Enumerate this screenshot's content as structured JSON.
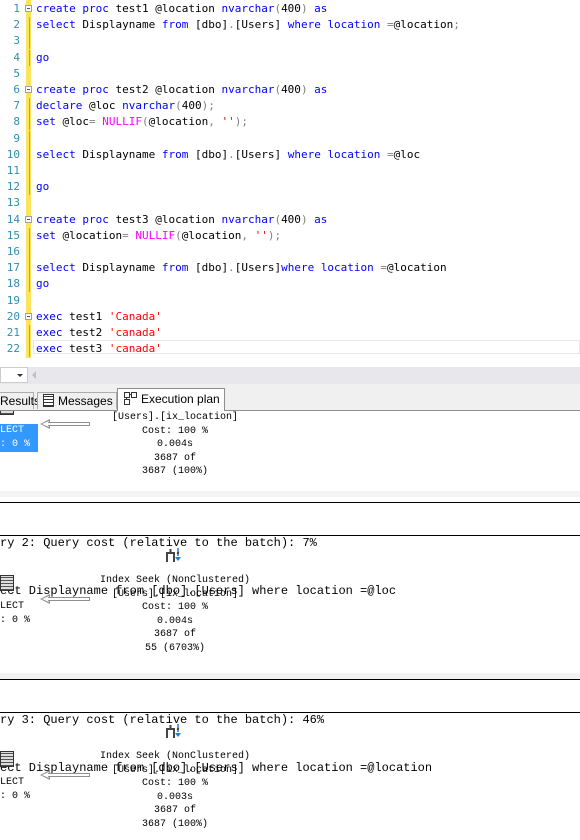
{
  "editor": {
    "lines": [
      {
        "n": "1",
        "fold": true,
        "segments": [
          [
            "kw",
            "create proc "
          ],
          [
            "",
            "test1 @location "
          ],
          [
            "kw",
            "nvarchar"
          ],
          [
            "op",
            "("
          ],
          [
            "",
            "400"
          ],
          [
            "op",
            ")"
          ],
          [
            "kw",
            " as"
          ]
        ]
      },
      {
        "n": "2",
        "segments": [
          [
            "kw",
            "select "
          ],
          [
            "",
            "Displayname "
          ],
          [
            "kw",
            "from "
          ],
          [
            "",
            "[dbo]"
          ],
          [
            "op",
            "."
          ],
          [
            "",
            "[Users] "
          ],
          [
            "kw",
            "where location "
          ],
          [
            "op",
            "="
          ],
          [
            "",
            "@location"
          ],
          [
            "op",
            ";"
          ]
        ]
      },
      {
        "n": "3",
        "segments": []
      },
      {
        "n": "4",
        "segments": [
          [
            "kw",
            "go"
          ]
        ]
      },
      {
        "n": "5",
        "segments": []
      },
      {
        "n": "6",
        "fold": true,
        "segments": [
          [
            "kw",
            "create proc "
          ],
          [
            "",
            "test2 @location "
          ],
          [
            "kw",
            "nvarchar"
          ],
          [
            "op",
            "("
          ],
          [
            "",
            "400"
          ],
          [
            "op",
            ")"
          ],
          [
            "kw",
            " as"
          ]
        ]
      },
      {
        "n": "7",
        "segments": [
          [
            "kw",
            "declare "
          ],
          [
            "",
            "@loc "
          ],
          [
            "kw",
            "nvarchar"
          ],
          [
            "op",
            "("
          ],
          [
            "",
            "400"
          ],
          [
            "op",
            ");"
          ]
        ]
      },
      {
        "n": "8",
        "segments": [
          [
            "kw",
            "set "
          ],
          [
            "",
            "@loc"
          ],
          [
            "op",
            "= "
          ],
          [
            "fn",
            "NULLIF"
          ],
          [
            "op",
            "("
          ],
          [
            "",
            "@location"
          ],
          [
            "op",
            ", "
          ],
          [
            "str",
            "''"
          ],
          [
            "op",
            ");"
          ]
        ]
      },
      {
        "n": "9",
        "segments": []
      },
      {
        "n": "10",
        "segments": [
          [
            "kw",
            "select "
          ],
          [
            "",
            "Displayname "
          ],
          [
            "kw",
            "from "
          ],
          [
            "",
            "[dbo]"
          ],
          [
            "op",
            "."
          ],
          [
            "",
            "[Users] "
          ],
          [
            "kw",
            "where location "
          ],
          [
            "op",
            "="
          ],
          [
            "",
            "@loc"
          ]
        ]
      },
      {
        "n": "11",
        "segments": []
      },
      {
        "n": "12",
        "segments": [
          [
            "kw",
            "go"
          ]
        ]
      },
      {
        "n": "13",
        "segments": []
      },
      {
        "n": "14",
        "fold": true,
        "segments": [
          [
            "kw",
            "create proc "
          ],
          [
            "",
            "test3 @location "
          ],
          [
            "kw",
            "nvarchar"
          ],
          [
            "op",
            "("
          ],
          [
            "",
            "400"
          ],
          [
            "op",
            ")"
          ],
          [
            "kw",
            " as"
          ]
        ]
      },
      {
        "n": "15",
        "segments": [
          [
            "kw",
            "set "
          ],
          [
            "",
            "@location"
          ],
          [
            "op",
            "= "
          ],
          [
            "fn",
            "NULLIF"
          ],
          [
            "op",
            "("
          ],
          [
            "",
            "@location"
          ],
          [
            "op",
            ", "
          ],
          [
            "str",
            "''"
          ],
          [
            "op",
            ");"
          ]
        ]
      },
      {
        "n": "16",
        "segments": []
      },
      {
        "n": "17",
        "segments": [
          [
            "kw",
            "select "
          ],
          [
            "",
            "Displayname "
          ],
          [
            "kw",
            "from "
          ],
          [
            "",
            "[dbo]"
          ],
          [
            "op",
            "."
          ],
          [
            "",
            "[Users]"
          ],
          [
            "kw",
            "where location "
          ],
          [
            "op",
            "="
          ],
          [
            "",
            "@location"
          ]
        ]
      },
      {
        "n": "18",
        "segments": [
          [
            "kw",
            "go"
          ]
        ]
      },
      {
        "n": "19",
        "segments": []
      },
      {
        "n": "20",
        "fold": true,
        "segments": [
          [
            "kw",
            "exec "
          ],
          [
            "",
            "test1 "
          ],
          [
            "str",
            "'Canada'"
          ]
        ]
      },
      {
        "n": "21",
        "segments": [
          [
            "kw",
            "exec "
          ],
          [
            "",
            "test2 "
          ],
          [
            "str",
            "'canada'"
          ]
        ]
      },
      {
        "n": "22",
        "segments": [
          [
            "kw",
            "exec "
          ],
          [
            "",
            "test3 "
          ],
          [
            "str",
            "'canada'"
          ]
        ]
      }
    ]
  },
  "tabs": {
    "results": "Results",
    "messages": "Messages",
    "execution_plan": "Execution plan"
  },
  "plan": {
    "q1": {
      "select_label": "LECT",
      "select_cost": ": 0 %",
      "seek_lines": [
        "[Users].[ix_location]",
        "Cost: 100 %",
        "0.004s",
        "3687 of",
        "3687 (100%)"
      ]
    },
    "q2": {
      "header_line1": "ry 2: Query cost (relative to the batch): 7%",
      "header_line2": "ect Displayname from [dbo].[Users] where location =@loc",
      "select_label": "LECT",
      "select_cost": ": 0 %",
      "seek_lines": [
        "Index Seek (NonClustered)",
        "[Users].[ix_location]",
        "Cost: 100 %",
        "0.004s",
        "3687 of",
        "55 (6703%)"
      ]
    },
    "q3": {
      "header_line1": "ry 3: Query cost (relative to the batch): 46%",
      "header_line2": "ect Displayname from [dbo].[Users] where location =@location",
      "select_label": "LECT",
      "select_cost": ": 0 %",
      "seek_lines": [
        "Index Seek (NonClustered)",
        "[Users].[ix_location]",
        "Cost: 100 %",
        "0.003s",
        "3687 of",
        "3687 (100%)"
      ]
    }
  },
  "colors": {
    "keyword": "#0000ff",
    "function": "#ff00ff",
    "string": "#ff0000",
    "line_number": "#2b91af",
    "change_bar": "#fce45c",
    "selection": "#3399ff"
  }
}
